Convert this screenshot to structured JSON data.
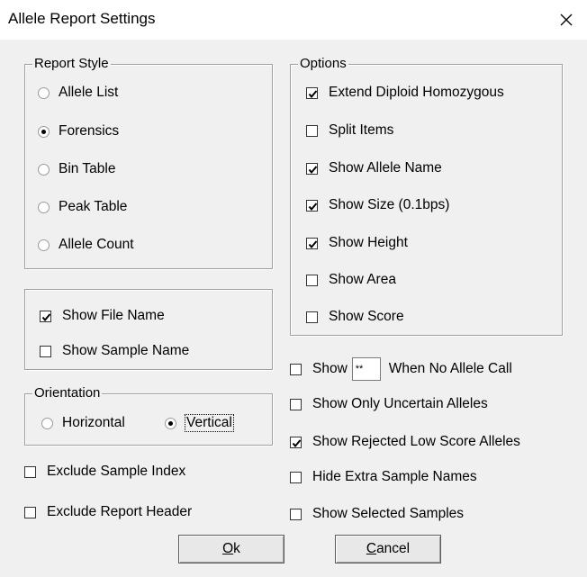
{
  "window": {
    "title": "Allele Report Settings",
    "close_glyph": "×"
  },
  "report_style": {
    "legend": "Report Style",
    "options": [
      {
        "label": "Allele List",
        "selected": false
      },
      {
        "label": "Forensics",
        "selected": true
      },
      {
        "label": "Bin Table",
        "selected": false
      },
      {
        "label": "Peak Table",
        "selected": false
      },
      {
        "label": "Allele Count",
        "selected": false
      }
    ]
  },
  "name_options": {
    "show_file_name": {
      "label": "Show File Name",
      "checked": true
    },
    "show_sample_name": {
      "label": "Show Sample Name",
      "checked": false
    }
  },
  "orientation": {
    "legend": "Orientation",
    "horizontal": {
      "label": "Horizontal",
      "selected": false
    },
    "vertical": {
      "label": "Vertical",
      "selected": true
    }
  },
  "exclude": {
    "sample_index": {
      "label": "Exclude Sample Index",
      "checked": false
    },
    "report_header": {
      "label": "Exclude Report Header",
      "checked": false
    }
  },
  "options": {
    "legend": "Options",
    "items": [
      {
        "label": "Extend Diploid Homozygous",
        "checked": true
      },
      {
        "label": "Split Items",
        "checked": false
      },
      {
        "label": "Show Allele Name",
        "checked": true
      },
      {
        "label": "Show Size (0.1bps)",
        "checked": true
      },
      {
        "label": "Show Height",
        "checked": true
      },
      {
        "label": "Show Area",
        "checked": false
      },
      {
        "label": "Show Score",
        "checked": false
      }
    ]
  },
  "extra": {
    "show_when_no_call": {
      "prefix": "Show",
      "value": "**",
      "suffix": "When No Allele Call",
      "checked": false
    },
    "items": [
      {
        "label": "Show Only Uncertain Alleles",
        "checked": false
      },
      {
        "label": "Show Rejected Low Score Alleles",
        "checked": true
      },
      {
        "label": "Hide Extra Sample Names",
        "checked": false
      },
      {
        "label": "Show Selected Samples",
        "checked": false
      }
    ]
  },
  "buttons": {
    "ok": {
      "mnemonic": "O",
      "rest": "k"
    },
    "cancel": {
      "mnemonic": "C",
      "rest": "ancel"
    }
  }
}
